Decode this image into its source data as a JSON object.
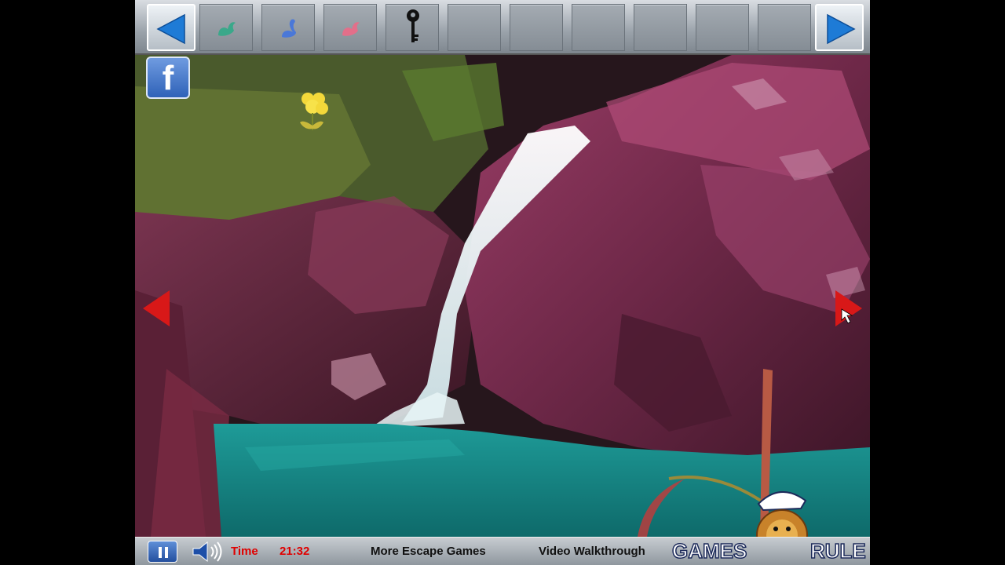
{
  "inventory": {
    "slots": [
      {
        "item": "green-bird-icon",
        "color": "#3aa88a"
      },
      {
        "item": "blue-swan-icon",
        "color": "#4a78d8"
      },
      {
        "item": "pink-bird-icon",
        "color": "#e36f8a"
      },
      {
        "item": "key-icon",
        "color": "#111111"
      },
      {
        "item": "",
        "color": ""
      },
      {
        "item": "",
        "color": ""
      },
      {
        "item": "",
        "color": ""
      },
      {
        "item": "",
        "color": ""
      },
      {
        "item": "",
        "color": ""
      }
    ]
  },
  "facebook": {
    "label": "f"
  },
  "bottom_bar": {
    "time_label": "Time",
    "time_value": "21:32",
    "more_games": "More Escape Games",
    "walkthrough": "Video Walkthrough",
    "logo_left": "GAMES",
    "logo_right": "RULE"
  },
  "colors": {
    "accent_blue": "#2a76d8",
    "nav_red": "#d81818",
    "water": "#1a8a86"
  }
}
